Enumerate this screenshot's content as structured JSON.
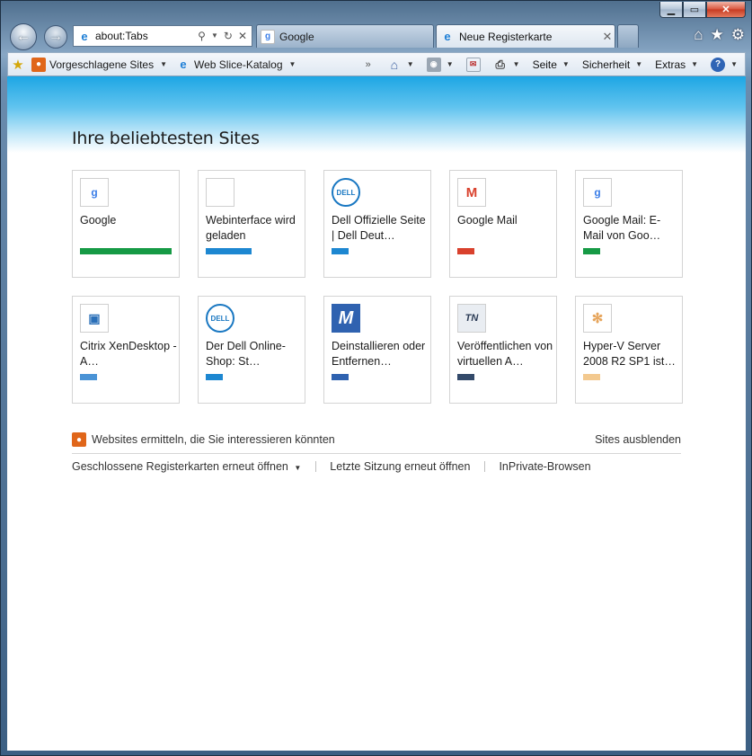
{
  "window": {
    "controls": [
      "minimize",
      "maximize",
      "close"
    ],
    "control_glyphs": {
      "minimize": "▁",
      "maximize": "▭",
      "close": "✕"
    }
  },
  "nav": {
    "address": "about:Tabs",
    "tabs": [
      {
        "label": "Google",
        "icon": "google-favicon",
        "active": false
      },
      {
        "label": "Neue Registerkarte",
        "icon": "ie-favicon",
        "active": true
      }
    ],
    "right_icons": [
      "home-icon",
      "favorites-star-icon",
      "gear-icon"
    ]
  },
  "command_bar": {
    "favorites": [
      {
        "label": "Vorgeschlagene Sites",
        "icon": "suggested-sites-icon"
      },
      {
        "label": "Web Slice-Katalog",
        "icon": "ie-favicon"
      }
    ],
    "tools": [
      {
        "label": "Seite"
      },
      {
        "label": "Sicherheit"
      },
      {
        "label": "Extras"
      }
    ],
    "icons": [
      "home-icon",
      "rss-icon",
      "mail-icon",
      "print-icon",
      "help-icon"
    ]
  },
  "page": {
    "heading": "Ihre beliebtesten Sites",
    "tiles": [
      {
        "label": "Google",
        "icon": "google-icon",
        "bar_fraction": 1.0,
        "bar_color": "#169a45"
      },
      {
        "label": "Webinterface wird geladen",
        "icon": "blank-icon",
        "bar_fraction": 0.5,
        "bar_color": "#1d87d1"
      },
      {
        "label": "Dell Offizielle Seite | Dell Deut…",
        "icon": "dell-logo-icon",
        "bar_fraction": 0.19,
        "bar_color": "#1d87d1"
      },
      {
        "label": "Google Mail",
        "icon": "gmail-icon",
        "bar_fraction": 0.19,
        "bar_color": "#d9412d"
      },
      {
        "label": "Google Mail: E-Mail von Goo…",
        "icon": "google-icon",
        "bar_fraction": 0.19,
        "bar_color": "#169a45"
      },
      {
        "label": "Citrix XenDesktop - A…",
        "icon": "citrix-icon",
        "bar_fraction": 0.19,
        "bar_color": "#4a93d6"
      },
      {
        "label": "Der Dell Online-Shop: St…",
        "icon": "dell-logo-icon",
        "bar_fraction": 0.19,
        "bar_color": "#1d87d1"
      },
      {
        "label": "Deinstallieren oder Entfernen…",
        "icon": "m-logo-icon",
        "bar_fraction": 0.19,
        "bar_color": "#2f62b0"
      },
      {
        "label": "Veröffentlichen von virtuellen A…",
        "icon": "tn-logo-icon",
        "bar_fraction": 0.19,
        "bar_color": "#334a6a"
      },
      {
        "label": "Hyper-V Server 2008 R2 SP1 ist…",
        "icon": "hyperv-icon",
        "bar_fraction": 0.19,
        "bar_color": "#f3c98f"
      }
    ],
    "suggest_link": "Websites ermitteln, die Sie interessieren könnten",
    "hide_link": "Sites ausblenden",
    "actions": [
      {
        "label": "Geschlossene Registerkarten erneut öffnen",
        "has_dropdown": true
      },
      {
        "label": "Letzte Sitzung erneut öffnen"
      },
      {
        "label": "InPrivate-Browsen"
      }
    ]
  }
}
